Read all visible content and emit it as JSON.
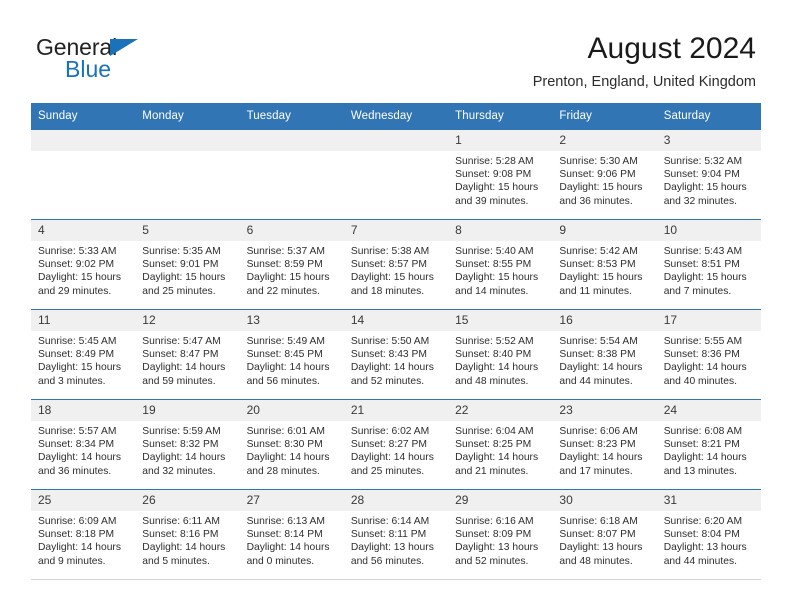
{
  "brand": {
    "name_part1": "General",
    "name_part2": "Blue",
    "triangle_icon": "brand-triangle-icon",
    "accent_color": "#1a72ba"
  },
  "header": {
    "title": "August 2024",
    "subtitle": "Prenton, England, United Kingdom"
  },
  "theme": {
    "header_blue": "#3175b4",
    "daynum_gray": "#f0f0f0",
    "text": "#2e2e2e"
  },
  "calendar": {
    "weekday_headers": [
      "Sunday",
      "Monday",
      "Tuesday",
      "Wednesday",
      "Thursday",
      "Friday",
      "Saturday"
    ],
    "labels": {
      "sunrise": "Sunrise:",
      "sunset": "Sunset:",
      "daylight": "Daylight:"
    },
    "weeks": [
      [
        {
          "day": "",
          "empty": true
        },
        {
          "day": "",
          "empty": true
        },
        {
          "day": "",
          "empty": true
        },
        {
          "day": "",
          "empty": true
        },
        {
          "day": "1",
          "sunrise": "Sunrise: 5:28 AM",
          "sunset": "Sunset: 9:08 PM",
          "daylight_l1": "Daylight: 15 hours",
          "daylight_l2": "and 39 minutes."
        },
        {
          "day": "2",
          "sunrise": "Sunrise: 5:30 AM",
          "sunset": "Sunset: 9:06 PM",
          "daylight_l1": "Daylight: 15 hours",
          "daylight_l2": "and 36 minutes."
        },
        {
          "day": "3",
          "sunrise": "Sunrise: 5:32 AM",
          "sunset": "Sunset: 9:04 PM",
          "daylight_l1": "Daylight: 15 hours",
          "daylight_l2": "and 32 minutes."
        }
      ],
      [
        {
          "day": "4",
          "sunrise": "Sunrise: 5:33 AM",
          "sunset": "Sunset: 9:02 PM",
          "daylight_l1": "Daylight: 15 hours",
          "daylight_l2": "and 29 minutes."
        },
        {
          "day": "5",
          "sunrise": "Sunrise: 5:35 AM",
          "sunset": "Sunset: 9:01 PM",
          "daylight_l1": "Daylight: 15 hours",
          "daylight_l2": "and 25 minutes."
        },
        {
          "day": "6",
          "sunrise": "Sunrise: 5:37 AM",
          "sunset": "Sunset: 8:59 PM",
          "daylight_l1": "Daylight: 15 hours",
          "daylight_l2": "and 22 minutes."
        },
        {
          "day": "7",
          "sunrise": "Sunrise: 5:38 AM",
          "sunset": "Sunset: 8:57 PM",
          "daylight_l1": "Daylight: 15 hours",
          "daylight_l2": "and 18 minutes."
        },
        {
          "day": "8",
          "sunrise": "Sunrise: 5:40 AM",
          "sunset": "Sunset: 8:55 PM",
          "daylight_l1": "Daylight: 15 hours",
          "daylight_l2": "and 14 minutes."
        },
        {
          "day": "9",
          "sunrise": "Sunrise: 5:42 AM",
          "sunset": "Sunset: 8:53 PM",
          "daylight_l1": "Daylight: 15 hours",
          "daylight_l2": "and 11 minutes."
        },
        {
          "day": "10",
          "sunrise": "Sunrise: 5:43 AM",
          "sunset": "Sunset: 8:51 PM",
          "daylight_l1": "Daylight: 15 hours",
          "daylight_l2": "and 7 minutes."
        }
      ],
      [
        {
          "day": "11",
          "sunrise": "Sunrise: 5:45 AM",
          "sunset": "Sunset: 8:49 PM",
          "daylight_l1": "Daylight: 15 hours",
          "daylight_l2": "and 3 minutes."
        },
        {
          "day": "12",
          "sunrise": "Sunrise: 5:47 AM",
          "sunset": "Sunset: 8:47 PM",
          "daylight_l1": "Daylight: 14 hours",
          "daylight_l2": "and 59 minutes."
        },
        {
          "day": "13",
          "sunrise": "Sunrise: 5:49 AM",
          "sunset": "Sunset: 8:45 PM",
          "daylight_l1": "Daylight: 14 hours",
          "daylight_l2": "and 56 minutes."
        },
        {
          "day": "14",
          "sunrise": "Sunrise: 5:50 AM",
          "sunset": "Sunset: 8:43 PM",
          "daylight_l1": "Daylight: 14 hours",
          "daylight_l2": "and 52 minutes."
        },
        {
          "day": "15",
          "sunrise": "Sunrise: 5:52 AM",
          "sunset": "Sunset: 8:40 PM",
          "daylight_l1": "Daylight: 14 hours",
          "daylight_l2": "and 48 minutes."
        },
        {
          "day": "16",
          "sunrise": "Sunrise: 5:54 AM",
          "sunset": "Sunset: 8:38 PM",
          "daylight_l1": "Daylight: 14 hours",
          "daylight_l2": "and 44 minutes."
        },
        {
          "day": "17",
          "sunrise": "Sunrise: 5:55 AM",
          "sunset": "Sunset: 8:36 PM",
          "daylight_l1": "Daylight: 14 hours",
          "daylight_l2": "and 40 minutes."
        }
      ],
      [
        {
          "day": "18",
          "sunrise": "Sunrise: 5:57 AM",
          "sunset": "Sunset: 8:34 PM",
          "daylight_l1": "Daylight: 14 hours",
          "daylight_l2": "and 36 minutes."
        },
        {
          "day": "19",
          "sunrise": "Sunrise: 5:59 AM",
          "sunset": "Sunset: 8:32 PM",
          "daylight_l1": "Daylight: 14 hours",
          "daylight_l2": "and 32 minutes."
        },
        {
          "day": "20",
          "sunrise": "Sunrise: 6:01 AM",
          "sunset": "Sunset: 8:30 PM",
          "daylight_l1": "Daylight: 14 hours",
          "daylight_l2": "and 28 minutes."
        },
        {
          "day": "21",
          "sunrise": "Sunrise: 6:02 AM",
          "sunset": "Sunset: 8:27 PM",
          "daylight_l1": "Daylight: 14 hours",
          "daylight_l2": "and 25 minutes."
        },
        {
          "day": "22",
          "sunrise": "Sunrise: 6:04 AM",
          "sunset": "Sunset: 8:25 PM",
          "daylight_l1": "Daylight: 14 hours",
          "daylight_l2": "and 21 minutes."
        },
        {
          "day": "23",
          "sunrise": "Sunrise: 6:06 AM",
          "sunset": "Sunset: 8:23 PM",
          "daylight_l1": "Daylight: 14 hours",
          "daylight_l2": "and 17 minutes."
        },
        {
          "day": "24",
          "sunrise": "Sunrise: 6:08 AM",
          "sunset": "Sunset: 8:21 PM",
          "daylight_l1": "Daylight: 14 hours",
          "daylight_l2": "and 13 minutes."
        }
      ],
      [
        {
          "day": "25",
          "sunrise": "Sunrise: 6:09 AM",
          "sunset": "Sunset: 8:18 PM",
          "daylight_l1": "Daylight: 14 hours",
          "daylight_l2": "and 9 minutes."
        },
        {
          "day": "26",
          "sunrise": "Sunrise: 6:11 AM",
          "sunset": "Sunset: 8:16 PM",
          "daylight_l1": "Daylight: 14 hours",
          "daylight_l2": "and 5 minutes."
        },
        {
          "day": "27",
          "sunrise": "Sunrise: 6:13 AM",
          "sunset": "Sunset: 8:14 PM",
          "daylight_l1": "Daylight: 14 hours",
          "daylight_l2": "and 0 minutes."
        },
        {
          "day": "28",
          "sunrise": "Sunrise: 6:14 AM",
          "sunset": "Sunset: 8:11 PM",
          "daylight_l1": "Daylight: 13 hours",
          "daylight_l2": "and 56 minutes."
        },
        {
          "day": "29",
          "sunrise": "Sunrise: 6:16 AM",
          "sunset": "Sunset: 8:09 PM",
          "daylight_l1": "Daylight: 13 hours",
          "daylight_l2": "and 52 minutes."
        },
        {
          "day": "30",
          "sunrise": "Sunrise: 6:18 AM",
          "sunset": "Sunset: 8:07 PM",
          "daylight_l1": "Daylight: 13 hours",
          "daylight_l2": "and 48 minutes."
        },
        {
          "day": "31",
          "sunrise": "Sunrise: 6:20 AM",
          "sunset": "Sunset: 8:04 PM",
          "daylight_l1": "Daylight: 13 hours",
          "daylight_l2": "and 44 minutes."
        }
      ]
    ]
  }
}
